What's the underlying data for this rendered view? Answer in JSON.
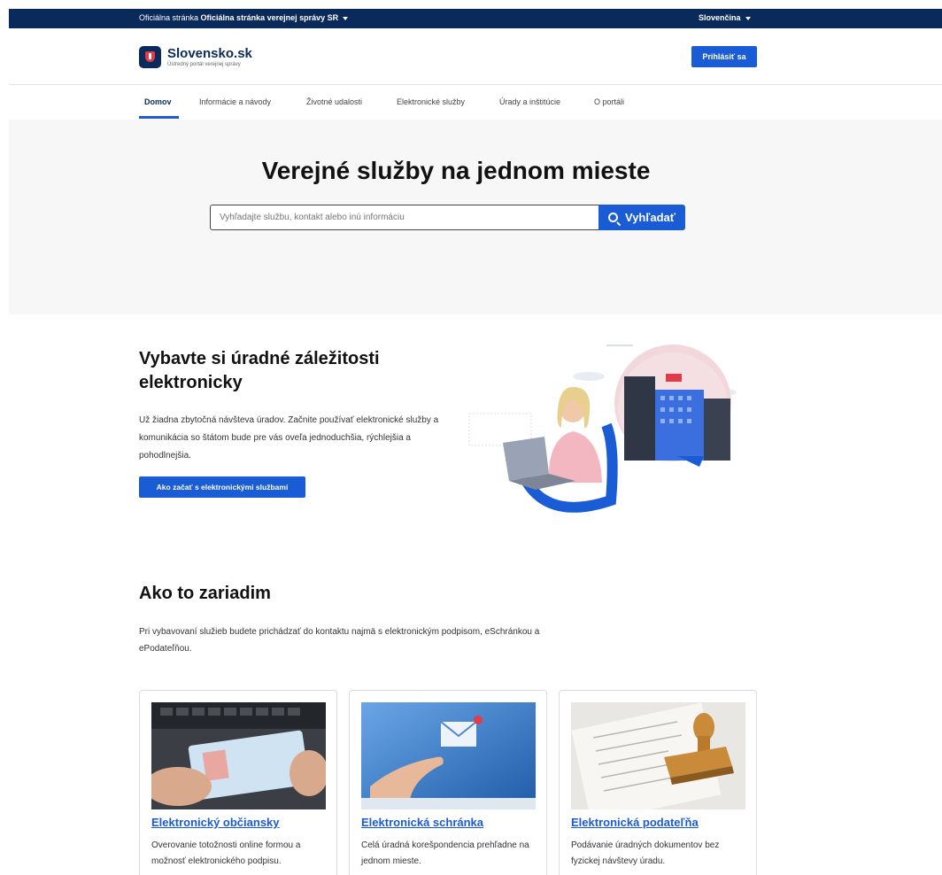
{
  "govbar": {
    "prefix": "Oficiálna stránka",
    "label": "Oficiálna stránka verejnej správy SR",
    "language": "Slovenčina"
  },
  "header": {
    "logo_name": "Slovensko.sk",
    "logo_subtitle": "Ústredný portál verejnej správy",
    "login_label": "Prihlásiť sa"
  },
  "nav": {
    "items": [
      {
        "label": "Domov",
        "active": true
      },
      {
        "label": "Informácie a návody"
      },
      {
        "label": "Životné udalosti"
      },
      {
        "label": "Elektronické služby"
      },
      {
        "label": "Úrady a inštitúcie"
      },
      {
        "label": "O portáli"
      }
    ]
  },
  "hero": {
    "title": "Verejné služby na jednom mieste",
    "search_placeholder": "Vyhľadajte službu, kontakt alebo inú informáciu",
    "search_button": "Vyhľadať"
  },
  "promo": {
    "title": "Vybavte si úradné záležitosti elektronicky",
    "text": "Už žiadna zbytočná návšteva úradov. Začnite používať elektronické služby a komunikácia so štátom bude pre vás oveľa jednoduchšia, rýchlejšia a pohodlnejšia.",
    "button": "Ako začať s elektronickými službami"
  },
  "how": {
    "title": "Ako to zariadim",
    "text": "Pri vybavovaní služieb budete prichádzať do kontaktu najmä s elektronickým podpisom, eSchránkou a ePodateľňou."
  },
  "cards": [
    {
      "title": "Elektronický občiansky",
      "text": "Overovanie totožnosti online formou a možnosť elektronického podpisu."
    },
    {
      "title": "Elektronická schránka",
      "text": "Celá úradná korešpondencia prehľadne na jednom mieste."
    },
    {
      "title": "Elektronická podateľňa",
      "text": "Podávanie úradných dokumentov bez fyzickej návštevy úradu."
    }
  ],
  "colors": {
    "primary": "#1a5bd6",
    "navy": "#0b2a5c",
    "hero_bg": "#f7f7f8"
  }
}
